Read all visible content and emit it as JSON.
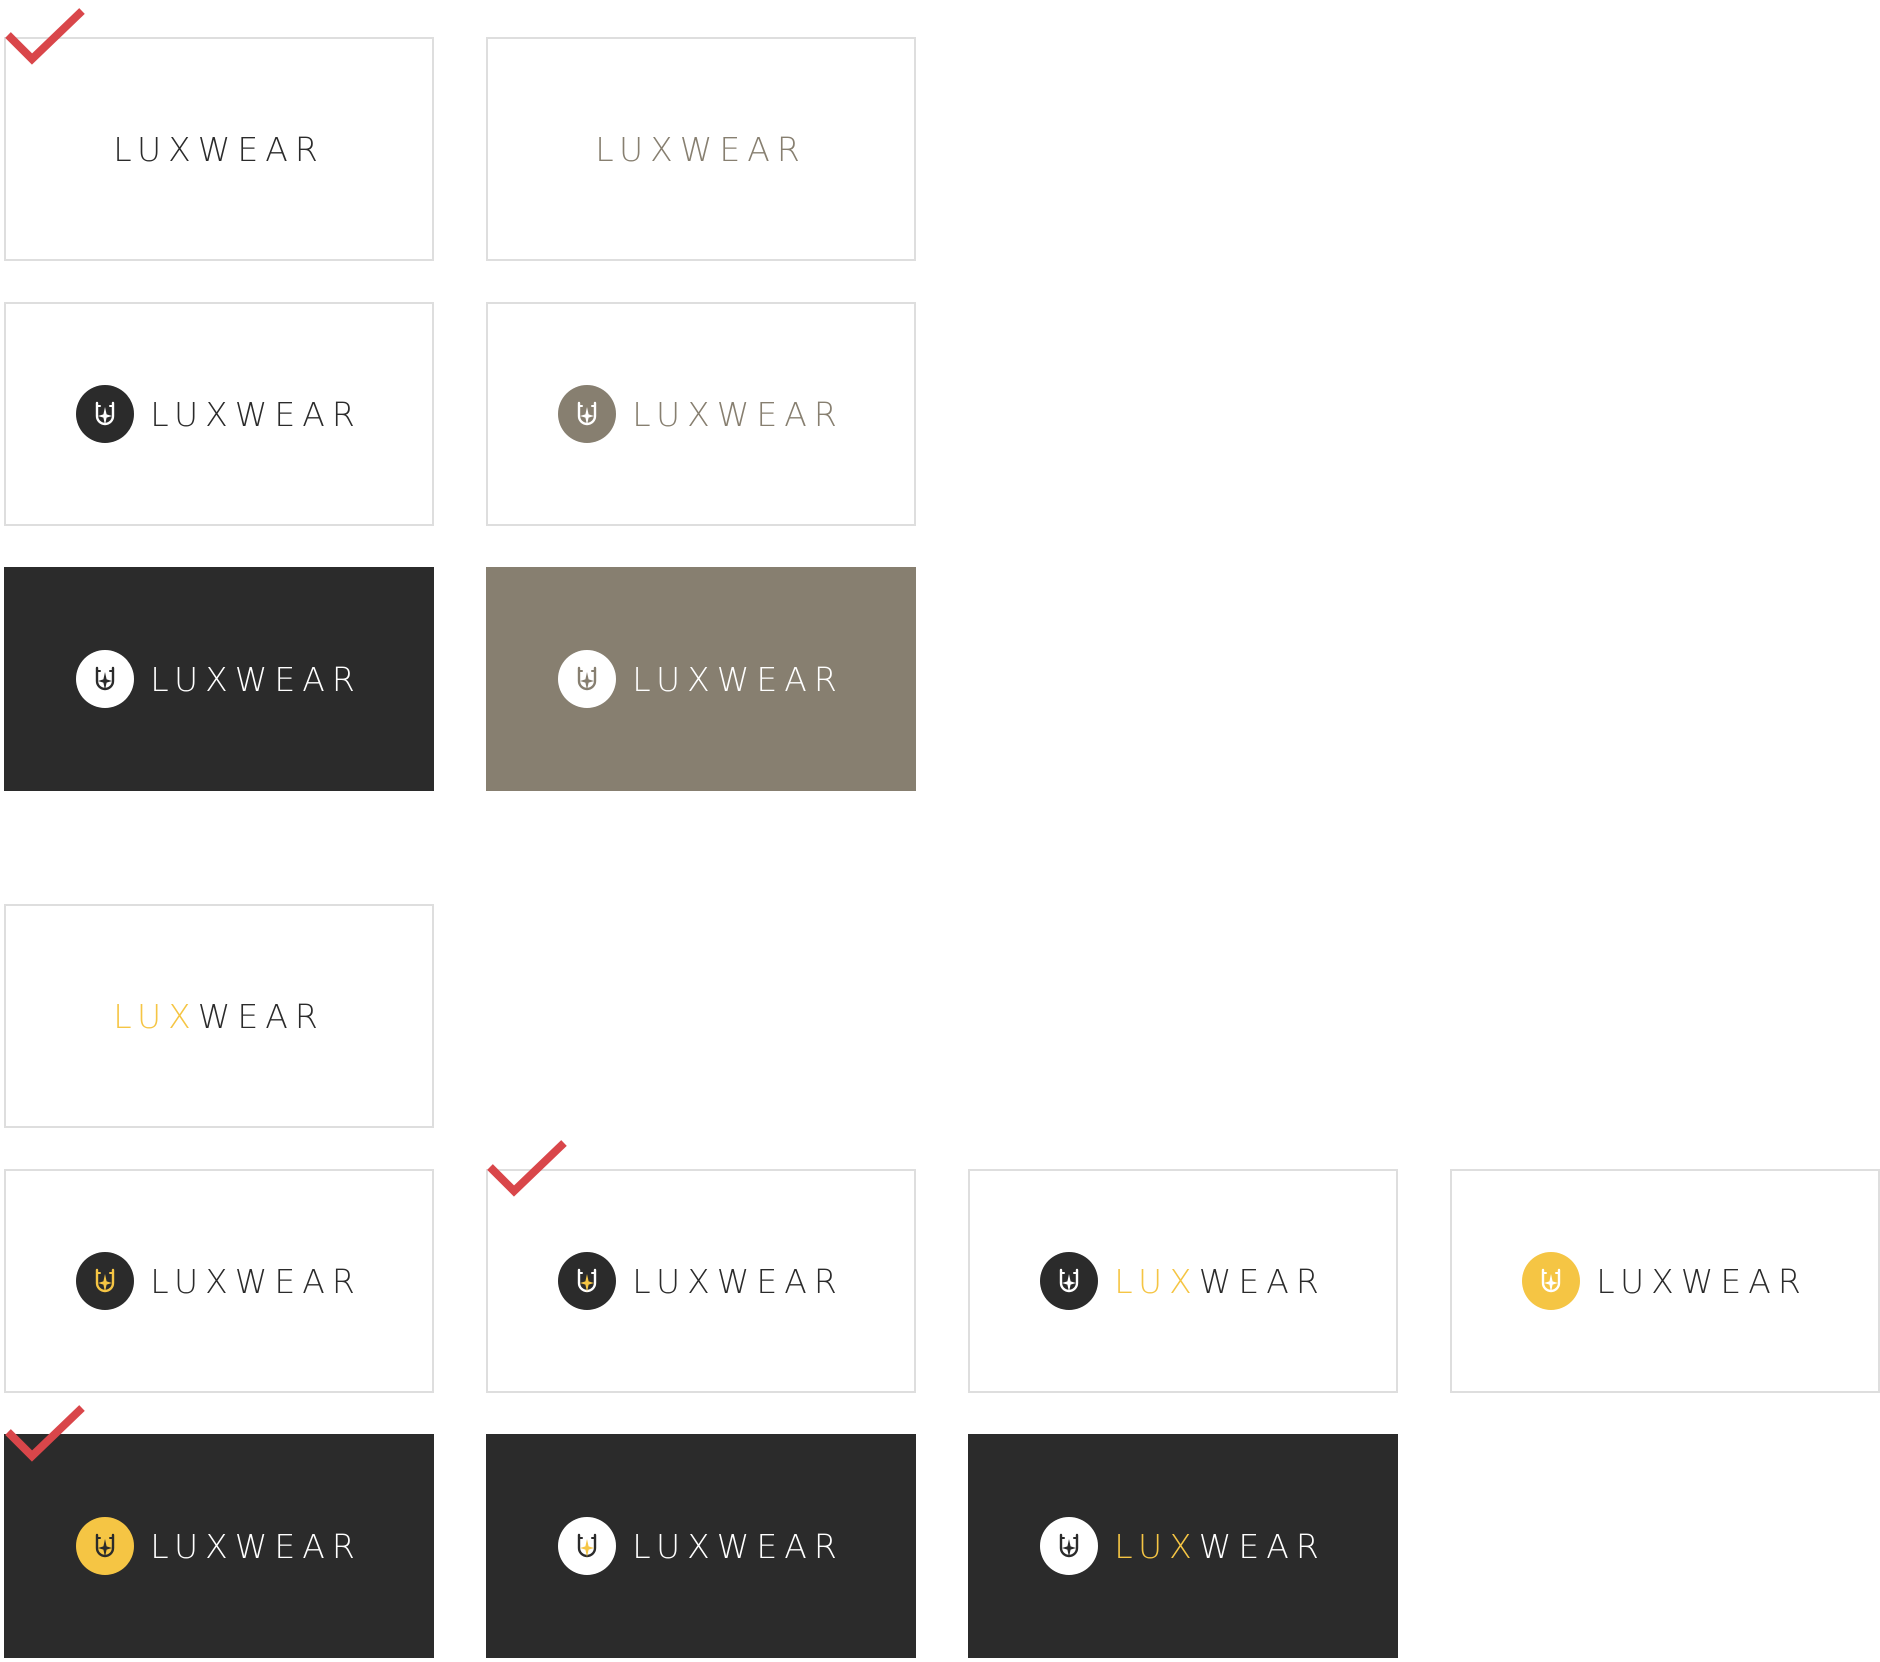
{
  "colors": {
    "dark": "#2b2b2b",
    "taupe": "#877f70",
    "gold": "#f5c544",
    "white": "#ffffff",
    "border": "#dedede",
    "check_red": "#d9464a"
  },
  "variants": [
    {
      "id": "r1c1",
      "background": "white",
      "emblem": "none",
      "lux_color": "dark",
      "wear_color": "dark",
      "checked": true,
      "wordmark": {
        "lux": "LUX",
        "wear": "WEAR"
      }
    },
    {
      "id": "r1c2",
      "background": "white",
      "emblem": "none",
      "lux_color": "taupe",
      "wear_color": "taupe",
      "checked": false,
      "wordmark": {
        "lux": "LUX",
        "wear": "WEAR"
      }
    },
    {
      "id": "r2c1",
      "background": "white",
      "emblem": "dark-circle-white-mark",
      "lux_color": "dark",
      "wear_color": "dark",
      "checked": false,
      "wordmark": {
        "lux": "LUX",
        "wear": "WEAR"
      }
    },
    {
      "id": "r2c2",
      "background": "white",
      "emblem": "taupe-circle-white-mark",
      "lux_color": "taupe",
      "wear_color": "taupe",
      "checked": false,
      "wordmark": {
        "lux": "LUX",
        "wear": "WEAR"
      }
    },
    {
      "id": "r3c1",
      "background": "dark",
      "emblem": "white-circle-dark-mark",
      "lux_color": "white",
      "wear_color": "white",
      "checked": false,
      "wordmark": {
        "lux": "LUX",
        "wear": "WEAR"
      }
    },
    {
      "id": "r3c2",
      "background": "taupe",
      "emblem": "white-circle-taupe-mark",
      "lux_color": "white",
      "wear_color": "white",
      "checked": false,
      "wordmark": {
        "lux": "LUX",
        "wear": "WEAR"
      }
    },
    {
      "id": "r4c1",
      "background": "white",
      "emblem": "none",
      "lux_color": "gold",
      "wear_color": "dark",
      "checked": false,
      "wordmark": {
        "lux": "LUX",
        "wear": "WEAR"
      }
    },
    {
      "id": "r5c1",
      "background": "white",
      "emblem": "dark-circle-gold-mark",
      "lux_color": "dark",
      "wear_color": "dark",
      "checked": false,
      "wordmark": {
        "lux": "LUX",
        "wear": "WEAR"
      }
    },
    {
      "id": "r5c2",
      "background": "white",
      "emblem": "dark-circle-gold-star",
      "lux_color": "dark",
      "wear_color": "dark",
      "checked": true,
      "wordmark": {
        "lux": "LUX",
        "wear": "WEAR"
      }
    },
    {
      "id": "r5c3",
      "background": "white",
      "emblem": "dark-circle-white-mark",
      "lux_color": "gold",
      "wear_color": "dark",
      "checked": false,
      "wordmark": {
        "lux": "LUX",
        "wear": "WEAR"
      }
    },
    {
      "id": "r5c4",
      "background": "white",
      "emblem": "gold-circle-white-mark",
      "lux_color": "dark",
      "wear_color": "dark",
      "checked": false,
      "wordmark": {
        "lux": "LUX",
        "wear": "WEAR"
      }
    },
    {
      "id": "r6c1",
      "background": "dark",
      "emblem": "gold-circle-dark-mark",
      "lux_color": "white",
      "wear_color": "white",
      "checked": true,
      "wordmark": {
        "lux": "LUX",
        "wear": "WEAR"
      }
    },
    {
      "id": "r6c2",
      "background": "dark",
      "emblem": "white-circle-dark-mark-gold-star",
      "lux_color": "white",
      "wear_color": "white",
      "checked": false,
      "wordmark": {
        "lux": "LUX",
        "wear": "WEAR"
      }
    },
    {
      "id": "r6c3",
      "background": "dark",
      "emblem": "white-circle-dark-mark",
      "lux_color": "gold",
      "wear_color": "white",
      "checked": false,
      "wordmark": {
        "lux": "LUX",
        "wear": "WEAR"
      }
    }
  ]
}
